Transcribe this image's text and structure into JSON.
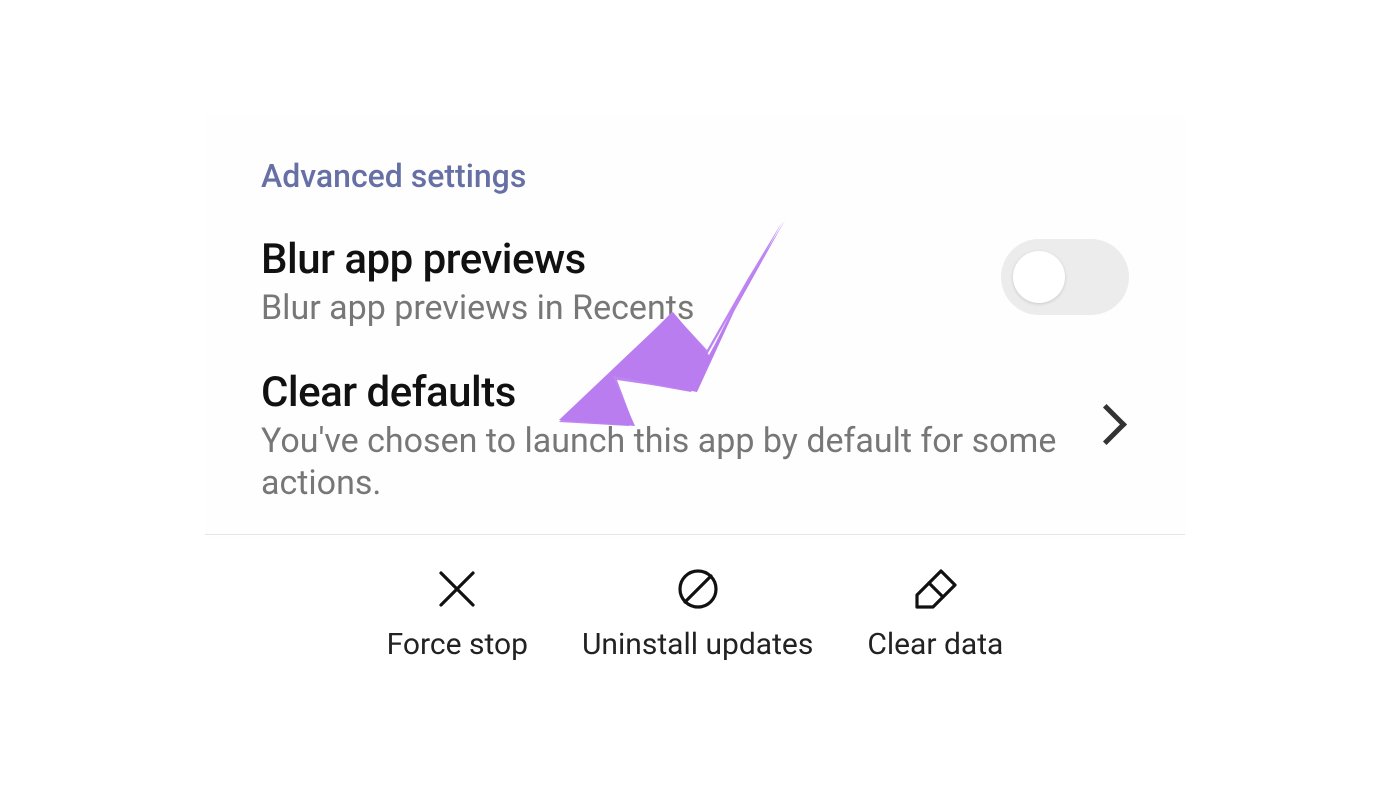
{
  "section_header": "Advanced settings",
  "rows": {
    "blur": {
      "title": "Blur app previews",
      "subtitle": "Blur app previews in Recents",
      "enabled": false
    },
    "clear_defaults": {
      "title": "Clear defaults",
      "subtitle": "You've chosen to launch this app by default for some actions."
    }
  },
  "bottom_actions": {
    "force_stop": "Force stop",
    "uninstall_updates": "Uninstall updates",
    "clear_data": "Clear data"
  },
  "annotation": {
    "color": "#b97df0"
  }
}
